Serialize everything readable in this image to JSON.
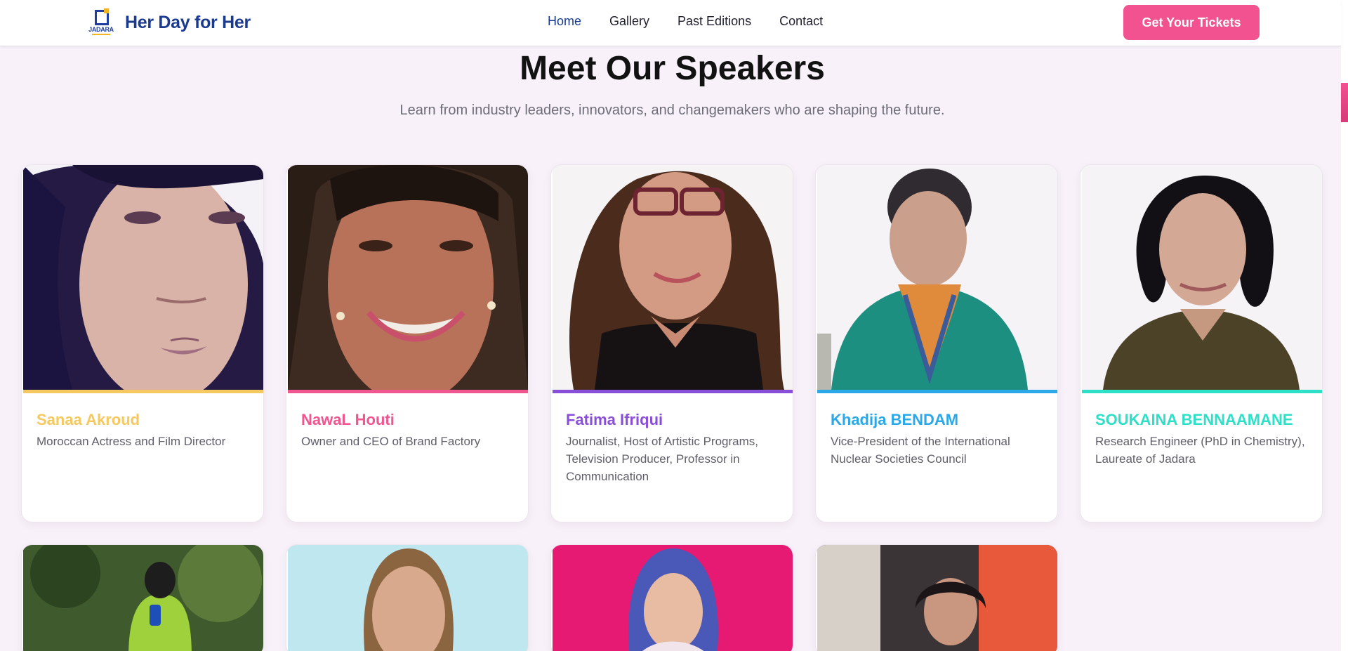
{
  "nav": {
    "brand_logo_text": "JADARA",
    "brand_name": "Her Day for Her",
    "links": [
      "Home",
      "Gallery",
      "Past Editions",
      "Contact"
    ],
    "cta": "Get Your Tickets"
  },
  "section": {
    "title": "Meet Our Speakers",
    "subtitle": "Learn from industry leaders, innovators, and changemakers who are shaping the future."
  },
  "speakers": [
    {
      "name": "Sanaa Akroud",
      "role": "Moroccan Actress and Film Director",
      "accent": "#f5c860"
    },
    {
      "name": "NawaL Houti",
      "role": "Owner and CEO of Brand Factory",
      "accent": "#f0568f"
    },
    {
      "name": "Fatima Ifriqui",
      "role": "Journalist, Host of Artistic Programs, Television Producer, Professor in Communication",
      "accent": "#8a4fd8"
    },
    {
      "name": "Khadija BENDAM",
      "role": "Vice-President of the International Nuclear Societies Council",
      "accent": "#2aa8e8"
    },
    {
      "name": "SOUKAINA BENNAAMANE",
      "role": "Research Engineer (PhD in Chemistry), Laureate of Jadara",
      "accent": "#2ee0c8"
    }
  ],
  "colors": {
    "brand": "#1a3a8f",
    "cta": "#f2528f",
    "page_bg": "#f8f1f9"
  }
}
